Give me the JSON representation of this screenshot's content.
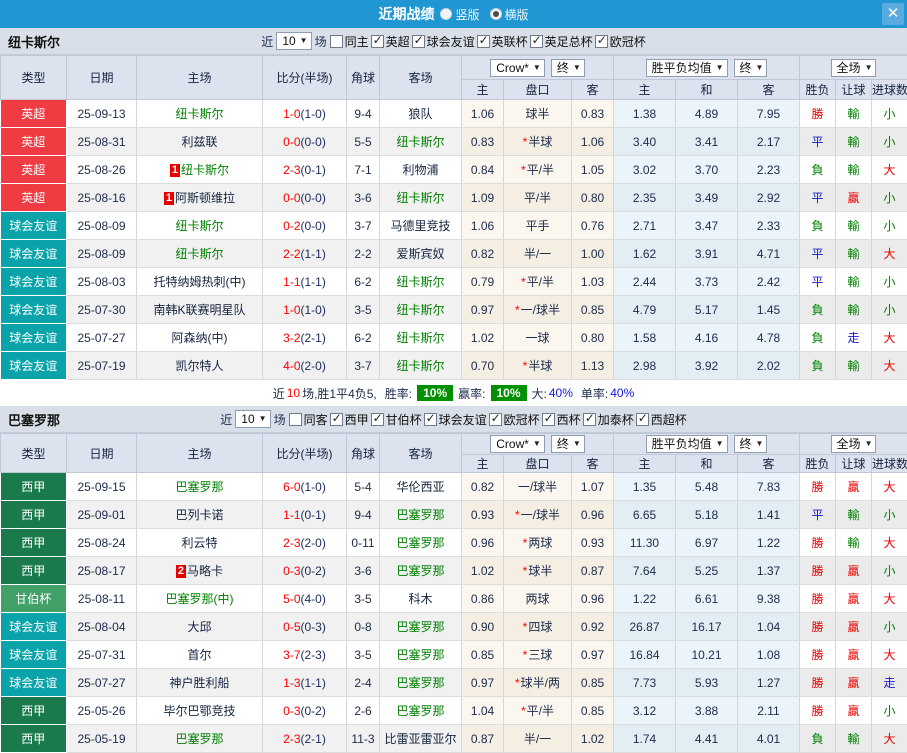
{
  "titlebar": {
    "title": "近期战绩",
    "radios": [
      {
        "label": "竖版",
        "checked": false
      },
      {
        "label": "横版",
        "checked": true
      }
    ],
    "close_glyph": "✕"
  },
  "table_header": {
    "cols": [
      "类型",
      "日期",
      "主场",
      "比分(半场)",
      "角球",
      "客场"
    ],
    "odds_source_dd": "Crow*",
    "final_dd": "终",
    "avg_dd": "胜平负均值",
    "final2_dd": "终",
    "scope_dd": "全场",
    "sub": [
      "主",
      "盘口",
      "客",
      "主",
      "和",
      "客",
      "胜负",
      "让球",
      "进球数"
    ]
  },
  "colors": {
    "accent_blue": "#2096d3",
    "epl_red": "#f03b43",
    "friendly_teal": "#0aa3aa",
    "laliga_green": "#1a7a4b",
    "gamper_green": "#41a169",
    "team_green": "#008000",
    "score_red": "#ff0000",
    "win_red": "#e60000",
    "draw_blue": "#1414d2",
    "lose_green": "#008000",
    "rate_badge_green": "#009000"
  },
  "sections": [
    {
      "team": "纽卡斯尔",
      "filter": {
        "near_label": "近",
        "games_value": "10",
        "games_suffix": "场",
        "checks": [
          {
            "label": "同主",
            "checked": false
          },
          {
            "label": "英超",
            "checked": true
          },
          {
            "label": "球会友谊",
            "checked": true
          },
          {
            "label": "英联杯",
            "checked": true
          },
          {
            "label": "英足总杯",
            "checked": true
          },
          {
            "label": "欧冠杯",
            "checked": true
          }
        ]
      },
      "rows": [
        {
          "type": "英超",
          "type_class": "lg-epl",
          "date": "25-09-13",
          "home": "纽卡斯尔",
          "home_green": true,
          "home_badge": "",
          "score": "1-0",
          "half": "(1-0)",
          "corner": "9-4",
          "away": "狼队",
          "away_green": false,
          "o1": "1.06",
          "hc": "球半",
          "hc_star": false,
          "o2": "0.83",
          "a1": "1.38",
          "a2": "4.89",
          "a3": "7.95",
          "r1": "勝",
          "r1c": "red",
          "r2": "輸",
          "r2c": "green",
          "r3": "小",
          "r3c": "green"
        },
        {
          "type": "英超",
          "type_class": "lg-epl",
          "date": "25-08-31",
          "home": "利兹联",
          "home_green": false,
          "home_badge": "",
          "score": "0-0",
          "half": "(0-0)",
          "corner": "5-5",
          "away": "纽卡斯尔",
          "away_green": true,
          "o1": "0.83",
          "hc": "半球",
          "hc_star": true,
          "o2": "1.06",
          "a1": "3.40",
          "a2": "3.41",
          "a3": "2.17",
          "r1": "平",
          "r1c": "blue",
          "r2": "輸",
          "r2c": "green",
          "r3": "小",
          "r3c": "green"
        },
        {
          "type": "英超",
          "type_class": "lg-epl",
          "date": "25-08-26",
          "home": "纽卡斯尔",
          "home_green": true,
          "home_badge": "1",
          "score": "2-3",
          "half": "(0-1)",
          "corner": "7-1",
          "away": "利物浦",
          "away_green": false,
          "o1": "0.84",
          "hc": "平/半",
          "hc_star": true,
          "o2": "1.05",
          "a1": "3.02",
          "a2": "3.70",
          "a3": "2.23",
          "r1": "負",
          "r1c": "green",
          "r2": "輸",
          "r2c": "green",
          "r3": "大",
          "r3c": "red"
        },
        {
          "type": "英超",
          "type_class": "lg-epl",
          "date": "25-08-16",
          "home": "阿斯顿维拉",
          "home_green": false,
          "home_badge": "1",
          "score": "0-0",
          "half": "(0-0)",
          "corner": "3-6",
          "away": "纽卡斯尔",
          "away_green": true,
          "o1": "1.09",
          "hc": "平/半",
          "hc_star": false,
          "o2": "0.80",
          "a1": "2.35",
          "a2": "3.49",
          "a3": "2.92",
          "r1": "平",
          "r1c": "blue",
          "r2": "贏",
          "r2c": "red",
          "r3": "小",
          "r3c": "green"
        },
        {
          "type": "球会友谊",
          "type_class": "lg-friendly",
          "date": "25-08-09",
          "home": "纽卡斯尔",
          "home_green": true,
          "home_badge": "",
          "score": "0-2",
          "half": "(0-0)",
          "corner": "3-7",
          "away": "马德里竞技",
          "away_green": false,
          "o1": "1.06",
          "hc": "平手",
          "hc_star": false,
          "o2": "0.76",
          "a1": "2.71",
          "a2": "3.47",
          "a3": "2.33",
          "r1": "負",
          "r1c": "green",
          "r2": "輸",
          "r2c": "green",
          "r3": "小",
          "r3c": "green"
        },
        {
          "type": "球会友谊",
          "type_class": "lg-friendly",
          "date": "25-08-09",
          "home": "纽卡斯尔",
          "home_green": true,
          "home_badge": "",
          "score": "2-2",
          "half": "(1-1)",
          "corner": "2-2",
          "away": "爱斯宾奴",
          "away_green": false,
          "o1": "0.82",
          "hc": "半/一",
          "hc_star": false,
          "o2": "1.00",
          "a1": "1.62",
          "a2": "3.91",
          "a3": "4.71",
          "r1": "平",
          "r1c": "blue",
          "r2": "輸",
          "r2c": "green",
          "r3": "大",
          "r3c": "red"
        },
        {
          "type": "球会友谊",
          "type_class": "lg-friendly",
          "date": "25-08-03",
          "home": "托特纳姆热刺(中)",
          "home_green": false,
          "home_badge": "",
          "score": "1-1",
          "half": "(1-1)",
          "corner": "6-2",
          "away": "纽卡斯尔",
          "away_green": true,
          "o1": "0.79",
          "hc": "平/半",
          "hc_star": true,
          "o2": "1.03",
          "a1": "2.44",
          "a2": "3.73",
          "a3": "2.42",
          "r1": "平",
          "r1c": "blue",
          "r2": "輸",
          "r2c": "green",
          "r3": "小",
          "r3c": "green"
        },
        {
          "type": "球会友谊",
          "type_class": "lg-friendly",
          "date": "25-07-30",
          "home": "南韩K联赛明星队",
          "home_green": false,
          "home_badge": "",
          "score": "1-0",
          "half": "(1-0)",
          "corner": "3-5",
          "away": "纽卡斯尔",
          "away_green": true,
          "o1": "0.97",
          "hc": "一/球半",
          "hc_star": true,
          "o2": "0.85",
          "a1": "4.79",
          "a2": "5.17",
          "a3": "1.45",
          "r1": "負",
          "r1c": "green",
          "r2": "輸",
          "r2c": "green",
          "r3": "小",
          "r3c": "green"
        },
        {
          "type": "球会友谊",
          "type_class": "lg-friendly",
          "date": "25-07-27",
          "home": "阿森纳(中)",
          "home_green": false,
          "home_badge": "",
          "score": "3-2",
          "half": "(2-1)",
          "corner": "6-2",
          "away": "纽卡斯尔",
          "away_green": true,
          "o1": "1.02",
          "hc": "一球",
          "hc_star": false,
          "o2": "0.80",
          "a1": "1.58",
          "a2": "4.16",
          "a3": "4.78",
          "r1": "負",
          "r1c": "green",
          "r2": "走",
          "r2c": "blue",
          "r3": "大",
          "r3c": "red"
        },
        {
          "type": "球会友谊",
          "type_class": "lg-friendly",
          "date": "25-07-19",
          "home": "凯尔特人",
          "home_green": false,
          "home_badge": "",
          "score": "4-0",
          "half": "(2-0)",
          "corner": "3-7",
          "away": "纽卡斯尔",
          "away_green": true,
          "o1": "0.70",
          "hc": "半球",
          "hc_star": true,
          "o2": "1.13",
          "a1": "2.98",
          "a2": "3.92",
          "a3": "2.02",
          "r1": "負",
          "r1c": "green",
          "r2": "輸",
          "r2c": "green",
          "r3": "大",
          "r3c": "red"
        }
      ],
      "summary": {
        "near": "近",
        "count": "10",
        "record": "场,胜1平4负5,",
        "win_rate_label": "胜率:",
        "win_rate": "10%",
        "cover_rate_label": "赢率:",
        "cover_rate": "10%",
        "big_label": "大:",
        "big": "40%",
        "single_label": "单率:",
        "single": "40%"
      }
    },
    {
      "team": "巴塞罗那",
      "filter": {
        "near_label": "近",
        "games_value": "10",
        "games_suffix": "场",
        "checks": [
          {
            "label": "同客",
            "checked": false
          },
          {
            "label": "西甲",
            "checked": true
          },
          {
            "label": "甘伯杯",
            "checked": true
          },
          {
            "label": "球会友谊",
            "checked": true
          },
          {
            "label": "欧冠杯",
            "checked": true
          },
          {
            "label": "西杯",
            "checked": true
          },
          {
            "label": "加泰杯",
            "checked": true
          },
          {
            "label": "西超杯",
            "checked": true
          }
        ]
      },
      "rows": [
        {
          "type": "西甲",
          "type_class": "lg-laliga",
          "date": "25-09-15",
          "home": "巴塞罗那",
          "home_green": true,
          "home_badge": "",
          "score": "6-0",
          "half": "(1-0)",
          "corner": "5-4",
          "away": "华伦西亚",
          "away_green": false,
          "o1": "0.82",
          "hc": "一/球半",
          "hc_star": false,
          "o2": "1.07",
          "a1": "1.35",
          "a2": "5.48",
          "a3": "7.83",
          "r1": "勝",
          "r1c": "red",
          "r2": "贏",
          "r2c": "red",
          "r3": "大",
          "r3c": "red"
        },
        {
          "type": "西甲",
          "type_class": "lg-laliga",
          "date": "25-09-01",
          "home": "巴列卡诺",
          "home_green": false,
          "home_badge": "",
          "score": "1-1",
          "half": "(0-1)",
          "corner": "9-4",
          "away": "巴塞罗那",
          "away_green": true,
          "o1": "0.93",
          "hc": "一/球半",
          "hc_star": true,
          "o2": "0.96",
          "a1": "6.65",
          "a2": "5.18",
          "a3": "1.41",
          "r1": "平",
          "r1c": "blue",
          "r2": "輸",
          "r2c": "green",
          "r3": "小",
          "r3c": "green"
        },
        {
          "type": "西甲",
          "type_class": "lg-laliga",
          "date": "25-08-24",
          "home": "利云特",
          "home_green": false,
          "home_badge": "",
          "score": "2-3",
          "half": "(2-0)",
          "corner": "0-11",
          "away": "巴塞罗那",
          "away_green": true,
          "o1": "0.96",
          "hc": "两球",
          "hc_star": true,
          "o2": "0.93",
          "a1": "11.30",
          "a2": "6.97",
          "a3": "1.22",
          "r1": "勝",
          "r1c": "red",
          "r2": "輸",
          "r2c": "green",
          "r3": "大",
          "r3c": "red"
        },
        {
          "type": "西甲",
          "type_class": "lg-laliga",
          "date": "25-08-17",
          "home": "马略卡",
          "home_green": false,
          "home_badge": "2",
          "score": "0-3",
          "half": "(0-2)",
          "corner": "3-6",
          "away": "巴塞罗那",
          "away_green": true,
          "o1": "1.02",
          "hc": "球半",
          "hc_star": true,
          "o2": "0.87",
          "a1": "7.64",
          "a2": "5.25",
          "a3": "1.37",
          "r1": "勝",
          "r1c": "red",
          "r2": "贏",
          "r2c": "red",
          "r3": "小",
          "r3c": "green"
        },
        {
          "type": "甘伯杯",
          "type_class": "lg-gamper",
          "date": "25-08-11",
          "home": "巴塞罗那(中)",
          "home_green": true,
          "home_badge": "",
          "score": "5-0",
          "half": "(4-0)",
          "corner": "3-5",
          "away": "科木",
          "away_green": false,
          "o1": "0.86",
          "hc": "两球",
          "hc_star": false,
          "o2": "0.96",
          "a1": "1.22",
          "a2": "6.61",
          "a3": "9.38",
          "r1": "勝",
          "r1c": "red",
          "r2": "贏",
          "r2c": "red",
          "r3": "大",
          "r3c": "red"
        },
        {
          "type": "球会友谊",
          "type_class": "lg-friendly",
          "date": "25-08-04",
          "home": "大邱",
          "home_green": false,
          "home_badge": "",
          "score": "0-5",
          "half": "(0-3)",
          "corner": "0-8",
          "away": "巴塞罗那",
          "away_green": true,
          "o1": "0.90",
          "hc": "四球",
          "hc_star": true,
          "o2": "0.92",
          "a1": "26.87",
          "a2": "16.17",
          "a3": "1.04",
          "r1": "勝",
          "r1c": "red",
          "r2": "贏",
          "r2c": "red",
          "r3": "小",
          "r3c": "green"
        },
        {
          "type": "球会友谊",
          "type_class": "lg-friendly",
          "date": "25-07-31",
          "home": "首尔",
          "home_green": false,
          "home_badge": "",
          "score": "3-7",
          "half": "(2-3)",
          "corner": "3-5",
          "away": "巴塞罗那",
          "away_green": true,
          "o1": "0.85",
          "hc": "三球",
          "hc_star": true,
          "o2": "0.97",
          "a1": "16.84",
          "a2": "10.21",
          "a3": "1.08",
          "r1": "勝",
          "r1c": "red",
          "r2": "贏",
          "r2c": "red",
          "r3": "大",
          "r3c": "red"
        },
        {
          "type": "球会友谊",
          "type_class": "lg-friendly",
          "date": "25-07-27",
          "home": "神户胜利船",
          "home_green": false,
          "home_badge": "",
          "score": "1-3",
          "half": "(1-1)",
          "corner": "2-4",
          "away": "巴塞罗那",
          "away_green": true,
          "o1": "0.97",
          "hc": "球半/两",
          "hc_star": true,
          "o2": "0.85",
          "a1": "7.73",
          "a2": "5.93",
          "a3": "1.27",
          "r1": "勝",
          "r1c": "red",
          "r2": "贏",
          "r2c": "red",
          "r3": "走",
          "r3c": "blue"
        },
        {
          "type": "西甲",
          "type_class": "lg-laliga",
          "date": "25-05-26",
          "home": "毕尔巴鄂竞技",
          "home_green": false,
          "home_badge": "",
          "score": "0-3",
          "half": "(0-2)",
          "corner": "2-6",
          "away": "巴塞罗那",
          "away_green": true,
          "o1": "1.04",
          "hc": "平/半",
          "hc_star": true,
          "o2": "0.85",
          "a1": "3.12",
          "a2": "3.88",
          "a3": "2.11",
          "r1": "勝",
          "r1c": "red",
          "r2": "贏",
          "r2c": "red",
          "r3": "小",
          "r3c": "green"
        },
        {
          "type": "西甲",
          "type_class": "lg-laliga",
          "date": "25-05-19",
          "home": "巴塞罗那",
          "home_green": true,
          "home_badge": "",
          "score": "2-3",
          "half": "(2-1)",
          "corner": "11-3",
          "away": "比雷亚雷亚尔",
          "away_green": false,
          "o1": "0.87",
          "hc": "半/一",
          "hc_star": false,
          "o2": "1.02",
          "a1": "1.74",
          "a2": "4.41",
          "a3": "4.01",
          "r1": "負",
          "r1c": "green",
          "r2": "輸",
          "r2c": "green",
          "r3": "大",
          "r3c": "red"
        }
      ],
      "summary": null
    }
  ]
}
